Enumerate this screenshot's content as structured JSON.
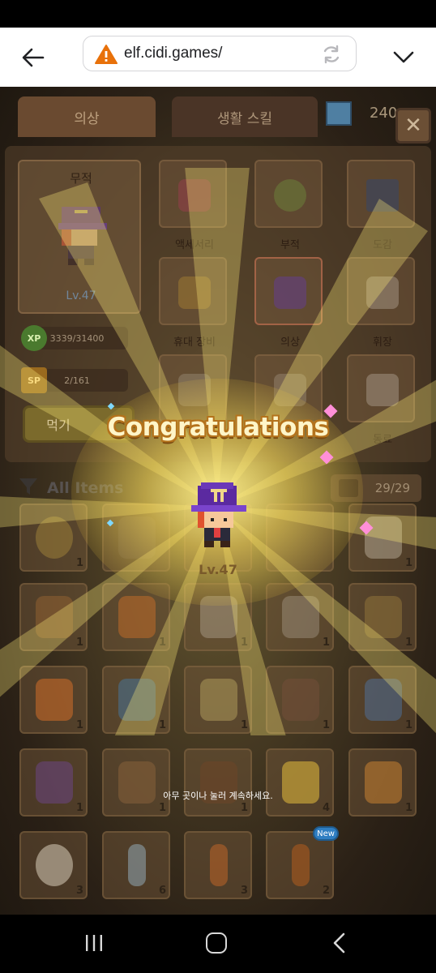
{
  "browser": {
    "url": "elf.cidi.games/",
    "warning_icon": "warning-triangle-icon",
    "colors": {
      "warning": "#e8710a"
    }
  },
  "game": {
    "tabs": [
      {
        "label": "의상"
      },
      {
        "label": "생활 스킬"
      }
    ],
    "gem_count": "240",
    "character": {
      "title": "무적",
      "level": "Lv.47",
      "xp": "3339/31400",
      "xp_badge": "XP",
      "sp": "2/161",
      "sp_badge": "SP",
      "eat_button": "먹기"
    },
    "equip_slots": [
      {
        "label": "액세서리"
      },
      {
        "label": "부적"
      },
      {
        "label": "도감"
      },
      {
        "label": "휴대 장비"
      },
      {
        "label": "의상"
      },
      {
        "label": "휘장"
      },
      {
        "label": "동료"
      }
    ],
    "inventory": {
      "filter_label": "All Items",
      "count": "29/29",
      "rows": [
        [
          "1",
          "",
          "",
          "",
          "1"
        ],
        [
          "1",
          "1",
          "1",
          "1",
          "1"
        ],
        [
          "1",
          "1",
          "1",
          "1",
          "1"
        ],
        [
          "1",
          "1",
          "1",
          "4",
          "1"
        ],
        [
          "3",
          "6",
          "3",
          "2",
          ""
        ]
      ],
      "new_badge": "New"
    },
    "celebration": {
      "title": "Congratulations",
      "level": "Lv.47",
      "hint": "아무 곳이나 눌러 계속하세요."
    }
  }
}
